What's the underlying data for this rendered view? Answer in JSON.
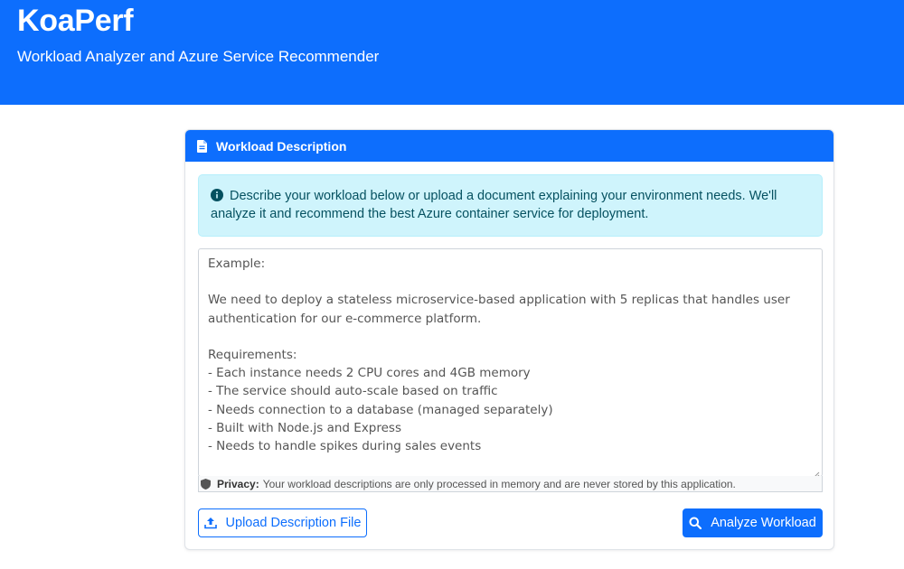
{
  "header": {
    "title": "KoaPerf",
    "subtitle": "Workload Analyzer and Azure Service Recommender"
  },
  "card": {
    "title": "Workload Description",
    "title_icon": "document-icon",
    "info_text": "Describe your workload below or upload a document explaining your environment needs. We'll analyze it and recommend the best Azure container service for deployment.",
    "info_icon": "info-circle-icon",
    "textarea_text": "Example:\n\nWe need to deploy a stateless microservice-based application with 5 replicas that handles user authentication for our e-commerce platform.\n\nRequirements:\n- Each instance needs 2 CPU cores and 4GB memory\n- The service should auto-scale based on traffic\n- Needs connection to a database (managed separately)\n- Built with Node.js and Express\n- Needs to handle spikes during sales events",
    "privacy_label": "Privacy:",
    "privacy_text": "Your workload descriptions are only processed in memory and are never stored by this application.",
    "privacy_icon": "shield-icon"
  },
  "actions": {
    "upload_label": "Upload Description File",
    "upload_icon": "upload-icon",
    "analyze_label": "Analyze Workload",
    "analyze_icon": "search-icon"
  },
  "colors": {
    "primary": "#0d6efd",
    "info_bg": "#cff4fc",
    "info_text": "#055160"
  }
}
